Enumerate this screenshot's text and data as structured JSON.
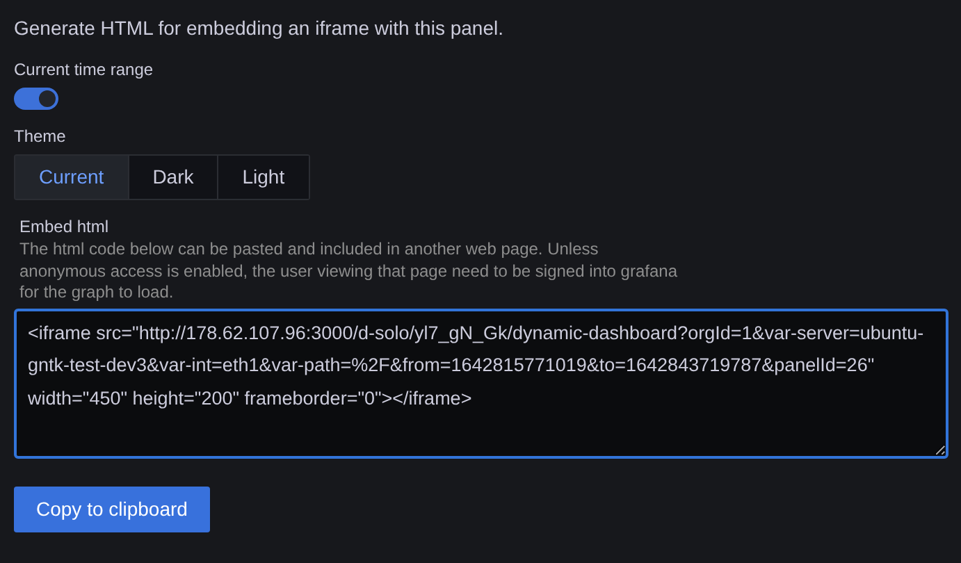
{
  "intro": "Generate HTML for embedding an iframe with this panel.",
  "time_range": {
    "label": "Current time range",
    "on": true
  },
  "theme": {
    "label": "Theme",
    "options": [
      {
        "label": "Current",
        "selected": true
      },
      {
        "label": "Dark",
        "selected": false
      },
      {
        "label": "Light",
        "selected": false
      }
    ]
  },
  "embed": {
    "label": "Embed html",
    "description": "The html code below can be pasted and included in another web page. Unless anonymous access is enabled, the user viewing that page need to be signed into grafana for the graph to load.",
    "value": "<iframe src=\"http://178.62.107.96:3000/d-solo/yl7_gN_Gk/dynamic-dashboard?orgId=1&var-server=ubuntu-gntk-test-dev3&var-int=eth1&var-path=%2F&from=1642815771019&to=1642843719787&panelId=26\" width=\"450\" height=\"200\" frameborder=\"0\"></iframe>"
  },
  "copy_button": "Copy to clipboard"
}
